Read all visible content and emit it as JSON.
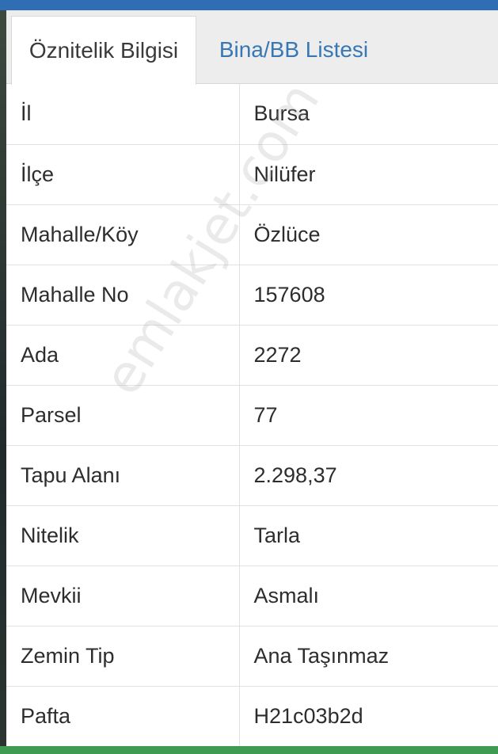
{
  "tabs": [
    {
      "label": "Öznitelik Bilgisi",
      "active": true
    },
    {
      "label": "Bina/BB Listesi",
      "active": false
    }
  ],
  "rows": [
    {
      "key": "İl",
      "value": "Bursa"
    },
    {
      "key": "İlçe",
      "value": "Nilüfer"
    },
    {
      "key": "Mahalle/Köy",
      "value": "Özlüce"
    },
    {
      "key": "Mahalle No",
      "value": "157608"
    },
    {
      "key": "Ada",
      "value": "2272"
    },
    {
      "key": "Parsel",
      "value": "77"
    },
    {
      "key": "Tapu Alanı",
      "value": "2.298,37"
    },
    {
      "key": "Nitelik",
      "value": "Tarla"
    },
    {
      "key": "Mevkii",
      "value": "Asmalı"
    },
    {
      "key": "Zemin Tip",
      "value": "Ana Taşınmaz"
    },
    {
      "key": "Pafta",
      "value": "H21c03b2d"
    }
  ],
  "watermark": "emlakjet.com",
  "colors": {
    "top_bar": "#2f6db5",
    "tab_link": "#3778b4",
    "bottom_bar": "#3f9a52"
  }
}
